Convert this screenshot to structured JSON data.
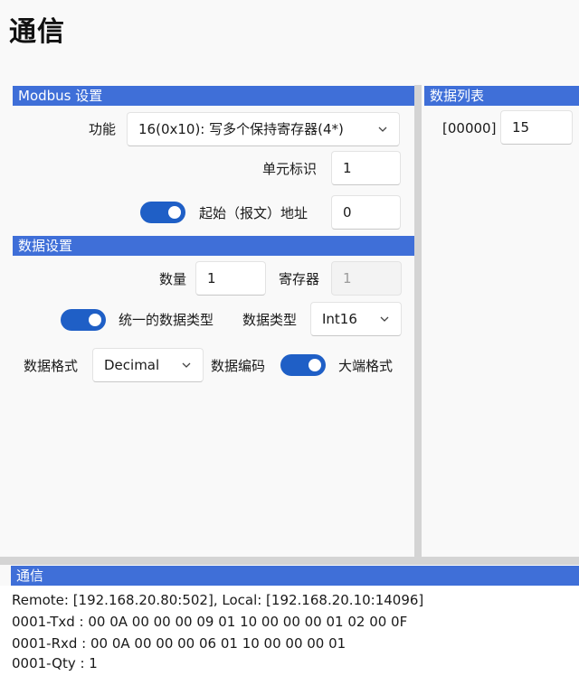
{
  "page": {
    "title": "通信"
  },
  "modbus": {
    "header": "Modbus 设置",
    "function_label": "功能",
    "function_value": "16(0x10): 写多个保持寄存器(4*)",
    "unit_id_label": "单元标识",
    "unit_id_value": "1",
    "start_addr_toggle_on": true,
    "start_addr_label": "起始（报文）地址",
    "start_addr_value": "0"
  },
  "data_settings": {
    "header": "数据设置",
    "quantity_label": "数量",
    "quantity_value": "1",
    "register_label": "寄存器",
    "register_value": "1",
    "unified_type_toggle_on": true,
    "unified_type_label": "统一的数据类型",
    "data_type_label": "数据类型",
    "data_type_value": "Int16",
    "data_format_label": "数据格式",
    "data_format_value": "Decimal",
    "data_encoding_label": "数据编码",
    "big_endian_toggle_on": true,
    "big_endian_label": "大端格式"
  },
  "data_list": {
    "header": "数据列表",
    "rows": [
      {
        "address": "[00000]",
        "value": "15"
      }
    ]
  },
  "comm": {
    "header": "通信",
    "lines": [
      "Remote: [192.168.20.80:502], Local: [192.168.20.10:14096]",
      "0001-Txd : 00 0A 00 00 00 09 01 10 00 00 00 01 02 00 0F",
      "0001-Rxd : 00 0A 00 00 00 06 01 10 00 00 00 01",
      "0001-Qty : 1"
    ]
  },
  "colors": {
    "section_header_bg": "#3f6fd8",
    "toggle_on": "#1f5fc6"
  },
  "icons": {
    "dropdown": "chevron-down-icon"
  }
}
